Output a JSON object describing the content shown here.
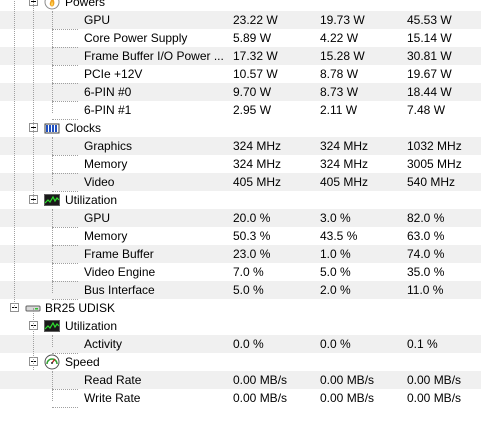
{
  "groups": [
    {
      "name": "Powers",
      "icon": "flame-icon",
      "rows": [
        {
          "label": "GPU",
          "v1": "23.22 W",
          "v2": "19.73 W",
          "v3": "45.53 W"
        },
        {
          "label": "Core Power Supply",
          "v1": "5.89 W",
          "v2": "4.22 W",
          "v3": "15.14 W"
        },
        {
          "label": "Frame Buffer I/O Power ...",
          "v1": "17.32 W",
          "v2": "15.28 W",
          "v3": "30.81 W"
        },
        {
          "label": "PCIe +12V",
          "v1": "10.57 W",
          "v2": "8.78 W",
          "v3": "19.67 W"
        },
        {
          "label": "6-PIN #0",
          "v1": "9.70 W",
          "v2": "8.73 W",
          "v3": "18.44 W"
        },
        {
          "label": "6-PIN #1",
          "v1": "2.95 W",
          "v2": "2.11 W",
          "v3": "7.48 W"
        }
      ]
    },
    {
      "name": "Clocks",
      "icon": "clock-bars-icon",
      "rows": [
        {
          "label": "Graphics",
          "v1": "324 MHz",
          "v2": "324 MHz",
          "v3": "1032 MHz"
        },
        {
          "label": "Memory",
          "v1": "324 MHz",
          "v2": "324 MHz",
          "v3": "3005 MHz"
        },
        {
          "label": "Video",
          "v1": "405 MHz",
          "v2": "405 MHz",
          "v3": "540 MHz"
        }
      ]
    },
    {
      "name": "Utilization",
      "icon": "utilization-graph-icon",
      "rows": [
        {
          "label": "GPU",
          "v1": "20.0 %",
          "v2": "3.0 %",
          "v3": "82.0 %"
        },
        {
          "label": "Memory",
          "v1": "50.3 %",
          "v2": "43.5 %",
          "v3": "63.0 %"
        },
        {
          "label": "Frame Buffer",
          "v1": "23.0 %",
          "v2": "1.0 %",
          "v3": "74.0 %"
        },
        {
          "label": "Video Engine",
          "v1": "7.0 %",
          "v2": "5.0 %",
          "v3": "35.0 %"
        },
        {
          "label": "Bus Interface",
          "v1": "5.0 %",
          "v2": "2.0 %",
          "v3": "11.0 %"
        }
      ]
    }
  ],
  "device": {
    "name": "BR25 UDISK",
    "icon": "disk-drive-icon",
    "groups": [
      {
        "name": "Utilization",
        "icon": "utilization-graph-icon",
        "rows": [
          {
            "label": "Activity",
            "v1": "0.0 %",
            "v2": "0.0 %",
            "v3": "0.1 %"
          }
        ]
      },
      {
        "name": "Speed",
        "icon": "speedometer-icon",
        "rows": [
          {
            "label": "Read Rate",
            "v1": "0.00 MB/s",
            "v2": "0.00 MB/s",
            "v3": "0.00 MB/s"
          },
          {
            "label": "Write Rate",
            "v1": "0.00 MB/s",
            "v2": "0.00 MB/s",
            "v3": "0.00 MB/s"
          }
        ]
      }
    ]
  }
}
